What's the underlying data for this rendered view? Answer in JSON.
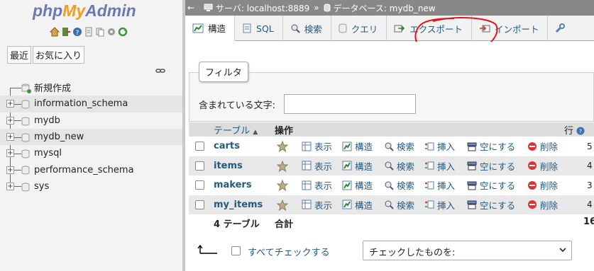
{
  "sidebar": {
    "logo": {
      "php": "php",
      "my": "My",
      "admin": "Admin"
    },
    "nav_tabs": [
      "最近",
      "お気に入り"
    ],
    "tree": [
      {
        "label": "新規作成",
        "type": "new"
      },
      {
        "label": "information_schema",
        "type": "db",
        "highlight": true
      },
      {
        "label": "mydb",
        "type": "db"
      },
      {
        "label": "mydb_new",
        "type": "db",
        "highlight": true
      },
      {
        "label": "mysql",
        "type": "db"
      },
      {
        "label": "performance_schema",
        "type": "db"
      },
      {
        "label": "sys",
        "type": "db"
      }
    ]
  },
  "breadcrumb": {
    "server": "サーバ: localhost:8889",
    "sep": "»",
    "database": "データベース: mydb_new"
  },
  "tabs": [
    {
      "label": "構造",
      "icon": "structure-icon",
      "active": true
    },
    {
      "label": "SQL",
      "icon": "sql-icon"
    },
    {
      "label": "検索",
      "icon": "search-icon"
    },
    {
      "label": "クエリ",
      "icon": "query-icon"
    },
    {
      "label": "エクスポート",
      "icon": "export-icon"
    },
    {
      "label": "インポート",
      "icon": "import-icon"
    },
    {
      "label": "",
      "icon": "operations-icon"
    }
  ],
  "filter": {
    "legend": "フィルタ",
    "label": "含まれている文字:",
    "value": ""
  },
  "table": {
    "headers": {
      "name": "テーブル",
      "sort": "▲",
      "action": "操作",
      "rows": "行"
    },
    "actions": [
      "表示",
      "構造",
      "検索",
      "挿入",
      "空にする",
      "削除"
    ],
    "rows": [
      {
        "name": "carts",
        "count": "5"
      },
      {
        "name": "items",
        "count": "4"
      },
      {
        "name": "makers",
        "count": "3"
      },
      {
        "name": "my_items",
        "count": "4"
      }
    ],
    "summary": {
      "tables": "4 テーブル",
      "total_label": "合計",
      "total": "16"
    }
  },
  "footer": {
    "check_all": "すべてチェックする",
    "with_selected": "チェックしたものを:"
  },
  "colors": {
    "link": "#235a81",
    "annotation": "#e0151b"
  }
}
